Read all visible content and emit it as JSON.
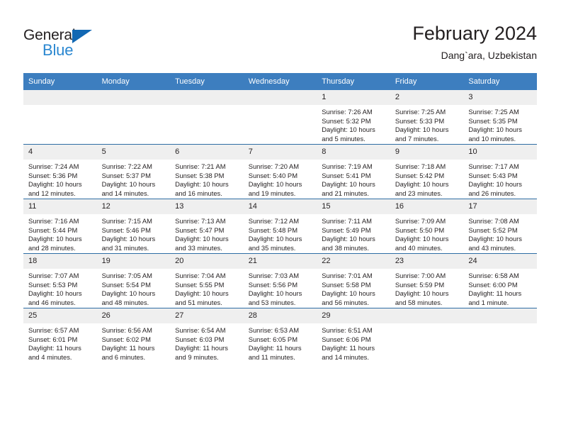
{
  "brand": {
    "name_part1": "General",
    "name_part2": "Blue",
    "triangle_color": "#1268b3",
    "blue_color": "#2a87d0"
  },
  "header": {
    "title": "February 2024",
    "subtitle": "Dang`ara, Uzbekistan"
  },
  "theme": {
    "header_bg": "#3d7ebf",
    "row_divider": "#2e6da4",
    "daynum_bg": "#efefef",
    "text": "#231f20"
  },
  "weekday_headers": [
    "Sunday",
    "Monday",
    "Tuesday",
    "Wednesday",
    "Thursday",
    "Friday",
    "Saturday"
  ],
  "labels": {
    "sunrise_prefix": "Sunrise:",
    "sunset_prefix": "Sunset:",
    "daylight_prefix": "Daylight:"
  },
  "weeks": [
    [
      {
        "day": "",
        "empty": true
      },
      {
        "day": "",
        "empty": true
      },
      {
        "day": "",
        "empty": true
      },
      {
        "day": "",
        "empty": true
      },
      {
        "day": "1",
        "sunrise": "Sunrise: 7:26 AM",
        "sunset": "Sunset: 5:32 PM",
        "daylight_l1": "Daylight: 10 hours",
        "daylight_l2": "and 5 minutes."
      },
      {
        "day": "2",
        "sunrise": "Sunrise: 7:25 AM",
        "sunset": "Sunset: 5:33 PM",
        "daylight_l1": "Daylight: 10 hours",
        "daylight_l2": "and 7 minutes."
      },
      {
        "day": "3",
        "sunrise": "Sunrise: 7:25 AM",
        "sunset": "Sunset: 5:35 PM",
        "daylight_l1": "Daylight: 10 hours",
        "daylight_l2": "and 10 minutes."
      }
    ],
    [
      {
        "day": "4",
        "sunrise": "Sunrise: 7:24 AM",
        "sunset": "Sunset: 5:36 PM",
        "daylight_l1": "Daylight: 10 hours",
        "daylight_l2": "and 12 minutes."
      },
      {
        "day": "5",
        "sunrise": "Sunrise: 7:22 AM",
        "sunset": "Sunset: 5:37 PM",
        "daylight_l1": "Daylight: 10 hours",
        "daylight_l2": "and 14 minutes."
      },
      {
        "day": "6",
        "sunrise": "Sunrise: 7:21 AM",
        "sunset": "Sunset: 5:38 PM",
        "daylight_l1": "Daylight: 10 hours",
        "daylight_l2": "and 16 minutes."
      },
      {
        "day": "7",
        "sunrise": "Sunrise: 7:20 AM",
        "sunset": "Sunset: 5:40 PM",
        "daylight_l1": "Daylight: 10 hours",
        "daylight_l2": "and 19 minutes."
      },
      {
        "day": "8",
        "sunrise": "Sunrise: 7:19 AM",
        "sunset": "Sunset: 5:41 PM",
        "daylight_l1": "Daylight: 10 hours",
        "daylight_l2": "and 21 minutes."
      },
      {
        "day": "9",
        "sunrise": "Sunrise: 7:18 AM",
        "sunset": "Sunset: 5:42 PM",
        "daylight_l1": "Daylight: 10 hours",
        "daylight_l2": "and 23 minutes."
      },
      {
        "day": "10",
        "sunrise": "Sunrise: 7:17 AM",
        "sunset": "Sunset: 5:43 PM",
        "daylight_l1": "Daylight: 10 hours",
        "daylight_l2": "and 26 minutes."
      }
    ],
    [
      {
        "day": "11",
        "sunrise": "Sunrise: 7:16 AM",
        "sunset": "Sunset: 5:44 PM",
        "daylight_l1": "Daylight: 10 hours",
        "daylight_l2": "and 28 minutes."
      },
      {
        "day": "12",
        "sunrise": "Sunrise: 7:15 AM",
        "sunset": "Sunset: 5:46 PM",
        "daylight_l1": "Daylight: 10 hours",
        "daylight_l2": "and 31 minutes."
      },
      {
        "day": "13",
        "sunrise": "Sunrise: 7:13 AM",
        "sunset": "Sunset: 5:47 PM",
        "daylight_l1": "Daylight: 10 hours",
        "daylight_l2": "and 33 minutes."
      },
      {
        "day": "14",
        "sunrise": "Sunrise: 7:12 AM",
        "sunset": "Sunset: 5:48 PM",
        "daylight_l1": "Daylight: 10 hours",
        "daylight_l2": "and 35 minutes."
      },
      {
        "day": "15",
        "sunrise": "Sunrise: 7:11 AM",
        "sunset": "Sunset: 5:49 PM",
        "daylight_l1": "Daylight: 10 hours",
        "daylight_l2": "and 38 minutes."
      },
      {
        "day": "16",
        "sunrise": "Sunrise: 7:09 AM",
        "sunset": "Sunset: 5:50 PM",
        "daylight_l1": "Daylight: 10 hours",
        "daylight_l2": "and 40 minutes."
      },
      {
        "day": "17",
        "sunrise": "Sunrise: 7:08 AM",
        "sunset": "Sunset: 5:52 PM",
        "daylight_l1": "Daylight: 10 hours",
        "daylight_l2": "and 43 minutes."
      }
    ],
    [
      {
        "day": "18",
        "sunrise": "Sunrise: 7:07 AM",
        "sunset": "Sunset: 5:53 PM",
        "daylight_l1": "Daylight: 10 hours",
        "daylight_l2": "and 46 minutes."
      },
      {
        "day": "19",
        "sunrise": "Sunrise: 7:05 AM",
        "sunset": "Sunset: 5:54 PM",
        "daylight_l1": "Daylight: 10 hours",
        "daylight_l2": "and 48 minutes."
      },
      {
        "day": "20",
        "sunrise": "Sunrise: 7:04 AM",
        "sunset": "Sunset: 5:55 PM",
        "daylight_l1": "Daylight: 10 hours",
        "daylight_l2": "and 51 minutes."
      },
      {
        "day": "21",
        "sunrise": "Sunrise: 7:03 AM",
        "sunset": "Sunset: 5:56 PM",
        "daylight_l1": "Daylight: 10 hours",
        "daylight_l2": "and 53 minutes."
      },
      {
        "day": "22",
        "sunrise": "Sunrise: 7:01 AM",
        "sunset": "Sunset: 5:58 PM",
        "daylight_l1": "Daylight: 10 hours",
        "daylight_l2": "and 56 minutes."
      },
      {
        "day": "23",
        "sunrise": "Sunrise: 7:00 AM",
        "sunset": "Sunset: 5:59 PM",
        "daylight_l1": "Daylight: 10 hours",
        "daylight_l2": "and 58 minutes."
      },
      {
        "day": "24",
        "sunrise": "Sunrise: 6:58 AM",
        "sunset": "Sunset: 6:00 PM",
        "daylight_l1": "Daylight: 11 hours",
        "daylight_l2": "and 1 minute."
      }
    ],
    [
      {
        "day": "25",
        "sunrise": "Sunrise: 6:57 AM",
        "sunset": "Sunset: 6:01 PM",
        "daylight_l1": "Daylight: 11 hours",
        "daylight_l2": "and 4 minutes."
      },
      {
        "day": "26",
        "sunrise": "Sunrise: 6:56 AM",
        "sunset": "Sunset: 6:02 PM",
        "daylight_l1": "Daylight: 11 hours",
        "daylight_l2": "and 6 minutes."
      },
      {
        "day": "27",
        "sunrise": "Sunrise: 6:54 AM",
        "sunset": "Sunset: 6:03 PM",
        "daylight_l1": "Daylight: 11 hours",
        "daylight_l2": "and 9 minutes."
      },
      {
        "day": "28",
        "sunrise": "Sunrise: 6:53 AM",
        "sunset": "Sunset: 6:05 PM",
        "daylight_l1": "Daylight: 11 hours",
        "daylight_l2": "and 11 minutes."
      },
      {
        "day": "29",
        "sunrise": "Sunrise: 6:51 AM",
        "sunset": "Sunset: 6:06 PM",
        "daylight_l1": "Daylight: 11 hours",
        "daylight_l2": "and 14 minutes."
      },
      {
        "day": "",
        "empty": true
      },
      {
        "day": "",
        "empty": true
      }
    ]
  ]
}
